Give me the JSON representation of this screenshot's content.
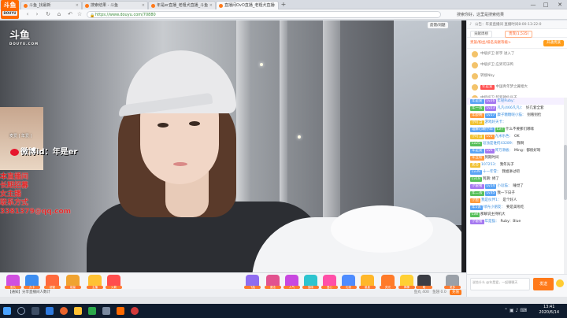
{
  "browser": {
    "tabs": [
      {
        "label": "斗鱼_找最新",
        "active": false
      },
      {
        "label": "搜索结果 - 斗鱼",
        "active": false
      },
      {
        "label": "年是er直播_老粗犬直播_斗鱼",
        "active": false
      },
      {
        "label": "直播间OvO直播_老粗犬直播",
        "active": true
      }
    ],
    "new_tab": "+",
    "url": "https://www.douyu.com/70880",
    "right_text": "搜索你好，这里是搜索结果",
    "window_controls": [
      "—",
      "□",
      "✕"
    ]
  },
  "corner_logo": {
    "main": "斗鱼",
    "sub": "DOUYU"
  },
  "video": {
    "watermark": "斗鱼",
    "watermark_sub": "DOUYU.COM",
    "camera_label": "麦爱 | 年爱 |",
    "weibo_text": "微博id：年是er",
    "red_overlay": "本直播间\n长期招募\n女主播\n联系方式\n3381379@qq.com",
    "tag": "反馈/问题"
  },
  "gifts": [
    {
      "name": "gift-1",
      "label": "鱼丸",
      "color": "#d04fe0"
    },
    {
      "name": "gift-2",
      "label": "办卡",
      "color": "#3c8df0"
    },
    {
      "name": "gift-3",
      "label": "超管",
      "color": "#ff6a3d"
    },
    {
      "name": "gift-4",
      "label": "能量",
      "color": "#f0a330"
    },
    {
      "name": "gift-5",
      "label": "主播",
      "color": "#ffc233"
    },
    {
      "name": "gift-6",
      "label": "火箭",
      "color": "#ff4d4d"
    },
    {
      "name": "gift-7",
      "label": "飞船",
      "color": "#8f6cf0"
    },
    {
      "name": "gift-8",
      "label": "魔法",
      "color": "#e2528f"
    },
    {
      "name": "gift-9",
      "label": "人气",
      "color": "#c848e0"
    },
    {
      "name": "gift-10",
      "label": "猫咪",
      "color": "#2ec4cf"
    },
    {
      "name": "gift-11",
      "label": "爱心",
      "color": "#ff4fa8"
    },
    {
      "name": "gift-12",
      "label": "礼物",
      "color": "#4e8cff"
    },
    {
      "name": "gift-13",
      "label": "星星",
      "color": "#ffb72a"
    },
    {
      "name": "gift-14",
      "label": "荧光",
      "color": "#ff7b2a"
    },
    {
      "name": "gift-15",
      "label": "棒棒",
      "color": "#ffd034"
    },
    {
      "name": "gift-16",
      "label": "暗",
      "color": "#3b3d44"
    },
    {
      "name": "gift-17",
      "label": "更多",
      "color": "#9aa0a8"
    }
  ],
  "bottom": {
    "left": "【通知】分享直播间人数计",
    "right_items": [
      "鱼丸 400",
      "鱼翅 0.0"
    ],
    "charge": "充值"
  },
  "sidebar": {
    "announcement": "公告：年爱直播间 直播时间8:00-13:22:0",
    "tabs": [
      {
        "label": "贡献周榜",
        "active": false
      },
      {
        "label": "贵宾(1,535)",
        "active": true
      }
    ],
    "rank_header": "贵族/粉丝/排名贡献等级>",
    "open_guard": "开通贵族",
    "rank_items": [
      {
        "badge": "",
        "text": "中级护卫 新宇 进入了"
      },
      {
        "badge": "",
        "text": "中级护卫 应男可乐鸭"
      },
      {
        "badge": "",
        "text": "转接Nby"
      },
      {
        "badge": "年是爱",
        "text": "中国青年梦之翼相大"
      },
      {
        "badge": "",
        "text": "中级护卫 超爱神仙豆子"
      }
    ],
    "messages": [
      {
        "badges": [
          [
            "b-blue",
            "年是爱"
          ],
          [
            "b-purple",
            "Lv26"
          ]
        ],
        "user": "年轻Ruby：",
        "text": "",
        "hl": true
      },
      {
        "badges": [
          [
            "b-green",
            "年一丢"
          ],
          [
            "b-purple",
            "Lv23"
          ]
        ],
        "user": "凡凡(466凡凡)：",
        "text": "好几套全套",
        "hl": false
      },
      {
        "badges": [
          [
            "b-orange",
            "年龄啊"
          ],
          [
            "b-blue",
            "Lv17"
          ]
        ],
        "user": "康子糖糖呢小猫：",
        "text": "别看别捡",
        "hl": false
      },
      {
        "badges": [
          [
            "b-yellow",
            "小叮当"
          ]
        ],
        "user": "游戏好天卡：",
        "text": "",
        "hl": false
      },
      {
        "badges": [
          [
            "b-blue",
            "理解心眼小卒"
          ],
          [
            "b-green",
            "Lv7"
          ]
        ],
        "user": "",
        "text": "什么不要那们哪嗦",
        "hl": false
      },
      {
        "badges": [
          [
            "b-yellow",
            "小叮当"
          ],
          [
            "b-orange",
            "Lv5"
          ]
        ],
        "user": "九米乐色：",
        "text": "OK",
        "hl": false
      },
      {
        "badges": [
          [
            "b-green",
            "Lv25"
          ]
        ],
        "user": "逗浊是谁何43289：",
        "text": "我啊",
        "hl": false
      },
      {
        "badges": [
          [
            "b-blue",
            "年是爱"
          ],
          [
            "b-purple",
            "Lv6"
          ]
        ],
        "user": "斧万滑板：",
        "text": "Ming：都很好呀",
        "hl": false
      },
      {
        "badges": [
          [
            "b-orange",
            "年豆粉"
          ]
        ],
        "user": "",
        "text": "到期时间",
        "hl": false
      },
      {
        "badges": [
          [
            "b-yellow",
            "麦杏"
          ]
        ],
        "user": "107253：",
        "text": "我年光子",
        "hl": false
      },
      {
        "badges": [
          [
            "b-blue",
            "Lv39"
          ]
        ],
        "user": "十一年雪：",
        "text": "我姐讲过吧",
        "hl": false
      },
      {
        "badges": [
          [
            "b-green",
            "Lv18"
          ]
        ],
        "user": "",
        "text": "到期: 捐了",
        "hl": false
      },
      {
        "badges": [
          [
            "b-purple",
            "小雷猪"
          ],
          [
            "b-blue",
            "Lv14"
          ]
        ],
        "user": "小逗猫：",
        "text": "睡觉了",
        "hl": false
      },
      {
        "badges": [
          [
            "b-green",
            "年二丢"
          ],
          [
            "b-blue",
            "Lv35"
          ]
        ],
        "user": "",
        "text": "我一下日子",
        "hl": false
      },
      {
        "badges": [
          [
            "b-orange",
            "小鱼"
          ]
        ],
        "user": "我是伙伴1：",
        "text": "是个好人",
        "hl": false
      },
      {
        "badges": [
          [
            "b-blue",
            "年1丢"
          ]
        ],
        "user": "绿光小朋友：",
        "text": "要是美啦吃",
        "hl": false
      },
      {
        "badges": [
          [
            "b-green",
            "Lv8"
          ]
        ],
        "user": "",
        "text": "那解说主持机大",
        "hl": false
      },
      {
        "badges": [
          [
            "b-purple",
            "小雷猪"
          ]
        ],
        "user": "年是猫：",
        "text": "Ruby：Blue",
        "hl": false
      }
    ],
    "input_placeholder": "说些什么 @年是爱，一起聊聊天",
    "send": "发送"
  },
  "taskbar": {
    "time": "13:41",
    "date": "2020/6/14"
  }
}
